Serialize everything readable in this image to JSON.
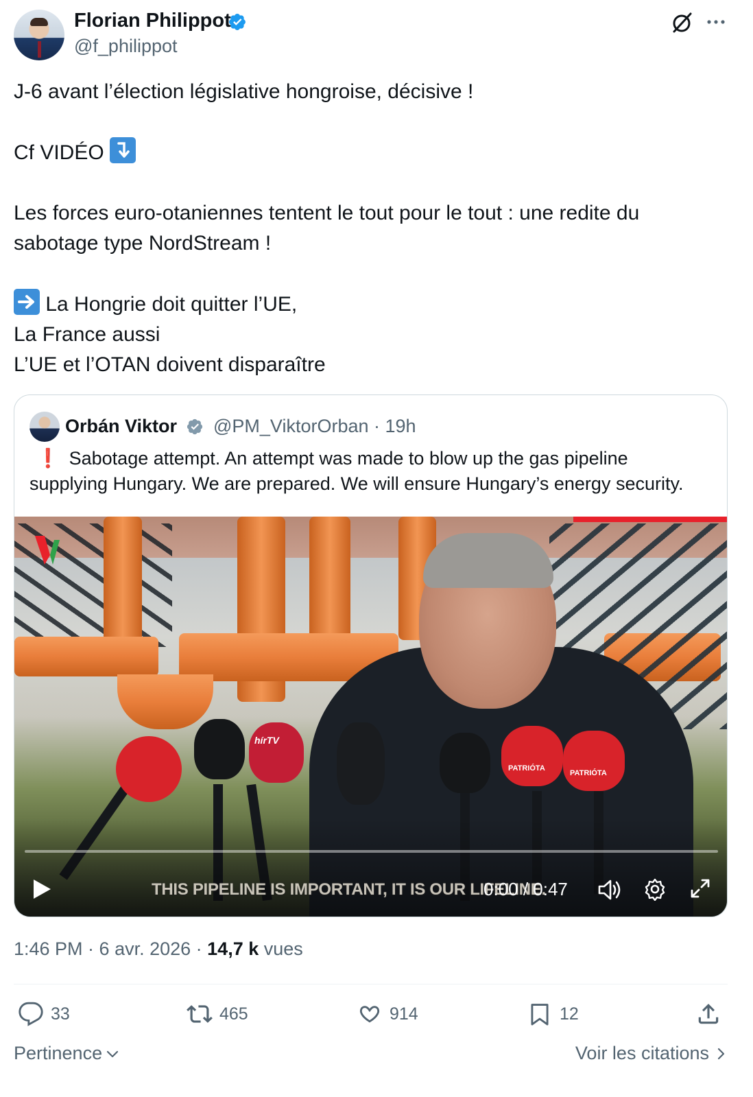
{
  "author": {
    "name": "Florian Philippot",
    "handle": "@f_philippot"
  },
  "tweet": {
    "line1": "J-6 avant l’élection législative hongroise, décisive !",
    "line2_text": "Cf VIDÉO",
    "line3": "Les forces euro-otaniennes tentent le tout pour le tout : une redite du",
    "line4": "sabotage type NordStream !",
    "line5_text": "La Hongrie doit quitter l’UE,",
    "line6": "La France aussi",
    "line7": "L’UE et l’OTAN doivent disparaître"
  },
  "quote": {
    "name": "Orbán Viktor",
    "handle": "@PM_ViktorOrban · 19h",
    "text_line1": "Sabotage attempt. An attempt was made to blow up the gas pipeline",
    "text_line2": "supplying Hungary. We are prepared. We will ensure Hungary’s energy security.",
    "excl": "❗",
    "video": {
      "subtitle": "THIS PIPELINE IS IMPORTANT, IT IS OUR LIFELINE.",
      "time": "0:00 / 0:47",
      "progress": 0.0,
      "mic_labels": {
        "patriota1": "PATRIÓTA",
        "patriota2": "PATRIÓTA",
        "hirtv": "hírTV"
      }
    }
  },
  "meta": {
    "time": "1:46 PM · 6 avr. 2026 · ",
    "views_count": "14,7 k",
    "views_label": " vues"
  },
  "actions": {
    "replies": "33",
    "reposts": "465",
    "likes": "914",
    "bookmarks": "12"
  },
  "footer": {
    "sort": "Pertinence",
    "quotes": "Voir les citations"
  },
  "colors": {
    "verified": "#1d9bf0",
    "text": "#0f1419",
    "secondary": "#536471",
    "border": "#cfd9de",
    "emoji_blue": "#3d8fd9"
  }
}
